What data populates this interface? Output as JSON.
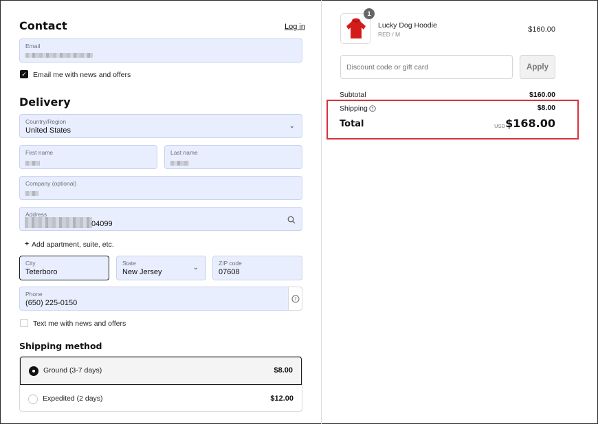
{
  "contact": {
    "title": "Contact",
    "login_link": "Log in",
    "email_label": "Email",
    "newsletter_label": "Email me with news and offers"
  },
  "delivery": {
    "title": "Delivery",
    "country_label": "Country/Region",
    "country_value": "United States",
    "first_name_label": "First name",
    "last_name_label": "Last name",
    "company_label": "Company (optional)",
    "address_label": "Address",
    "address_value_suffix": "04099",
    "add_apartment": "Add apartment, suite, etc.",
    "city_label": "City",
    "city_value": "Teterboro",
    "state_label": "State",
    "state_value": "New Jersey",
    "zip_label": "ZIP code",
    "zip_value": "07608",
    "phone_label": "Phone",
    "phone_value": "(650) 225-0150",
    "sms_label": "Text me with news and offers"
  },
  "shipping_method": {
    "title": "Shipping method",
    "options": [
      {
        "name": "Ground (3-7 days)",
        "price": "$8.00",
        "selected": true
      },
      {
        "name": "Expedited (2 days)",
        "price": "$12.00",
        "selected": false
      }
    ]
  },
  "order": {
    "quantity_badge": "1",
    "product_name": "Lucky Dog Hoodie",
    "product_variant": "RED / M",
    "product_price": "$160.00",
    "discount_placeholder": "Discount code or gift card",
    "apply_label": "Apply",
    "subtotal_label": "Subtotal",
    "subtotal_value": "$160.00",
    "shipping_label": "Shipping",
    "shipping_value": "$8.00",
    "total_label": "Total",
    "currency": "USD",
    "total_value": "$168.00"
  },
  "colors": {
    "field_bg": "#e8eefe",
    "highlight": "#d8313c",
    "hoodie": "#d41b1b"
  },
  "icons": [
    "chevron-down-icon",
    "search-icon",
    "help-circle-icon",
    "check-icon",
    "plus-icon",
    "hoodie-image"
  ]
}
